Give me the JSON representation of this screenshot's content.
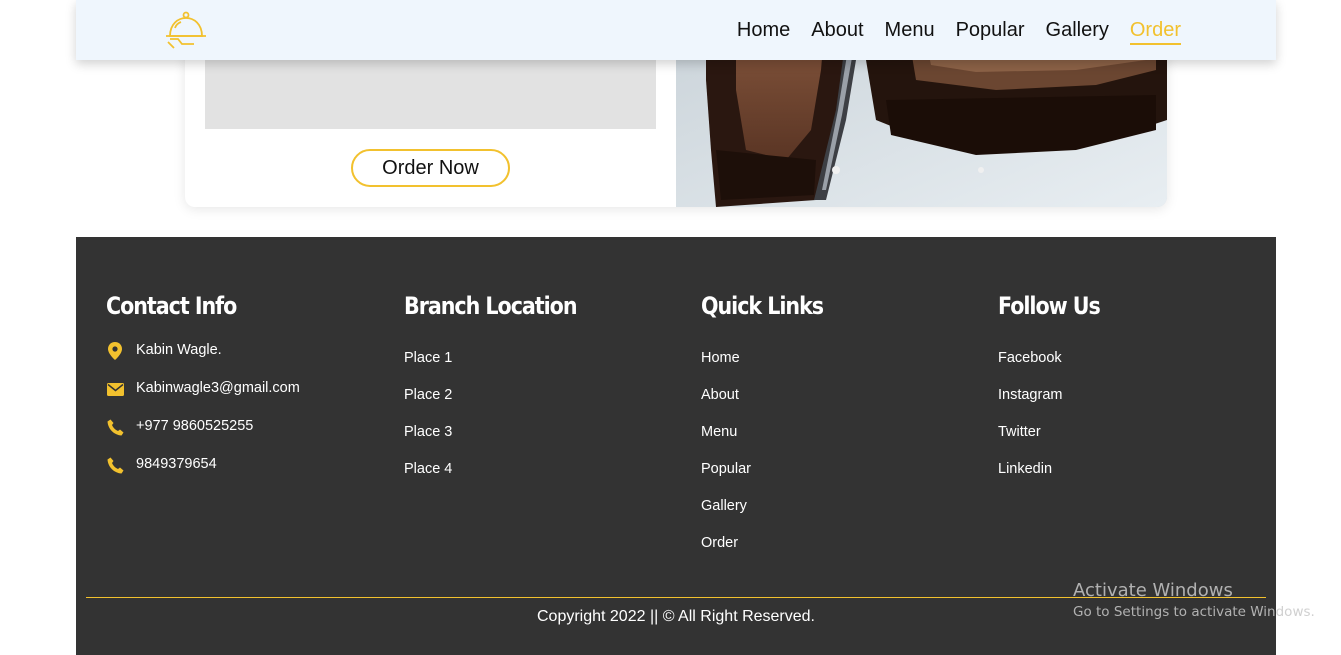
{
  "header": {
    "nav": [
      {
        "label": "Home",
        "active": false
      },
      {
        "label": "About",
        "active": false
      },
      {
        "label": "Menu",
        "active": false
      },
      {
        "label": "Popular",
        "active": false
      },
      {
        "label": "Gallery",
        "active": false
      },
      {
        "label": "Order",
        "active": true
      }
    ],
    "logo_icon": "cloche-icon",
    "accent_color": "#f2c12e"
  },
  "order_section": {
    "order_button_label": "Order Now",
    "image_icon": "chocolate-cake-image"
  },
  "footer": {
    "background": "#333333",
    "contact": {
      "title": "Contact Info",
      "items": [
        {
          "icon": "location-pin-icon",
          "text": "Kabin Wagle."
        },
        {
          "icon": "envelope-icon",
          "text": "Kabinwagle3@gmail.com"
        },
        {
          "icon": "phone-icon",
          "text": "+977 9860525255"
        },
        {
          "icon": "phone-icon",
          "text": "9849379654"
        }
      ]
    },
    "branch": {
      "title": "Branch Location",
      "items": [
        "Place 1",
        "Place 2",
        "Place 3",
        "Place 4"
      ]
    },
    "quick_links": {
      "title": "Quick Links",
      "items": [
        "Home",
        "About",
        "Menu",
        "Popular",
        "Gallery",
        "Order"
      ]
    },
    "follow": {
      "title": "Follow Us",
      "items": [
        "Facebook",
        "Instagram",
        "Twitter",
        "Linkedin"
      ]
    },
    "copyright": "Copyright 2022 || © All Right Reserved."
  },
  "watermark": {
    "line1": "Activate Windows",
    "line2": "Go to Settings to activate Windows."
  }
}
